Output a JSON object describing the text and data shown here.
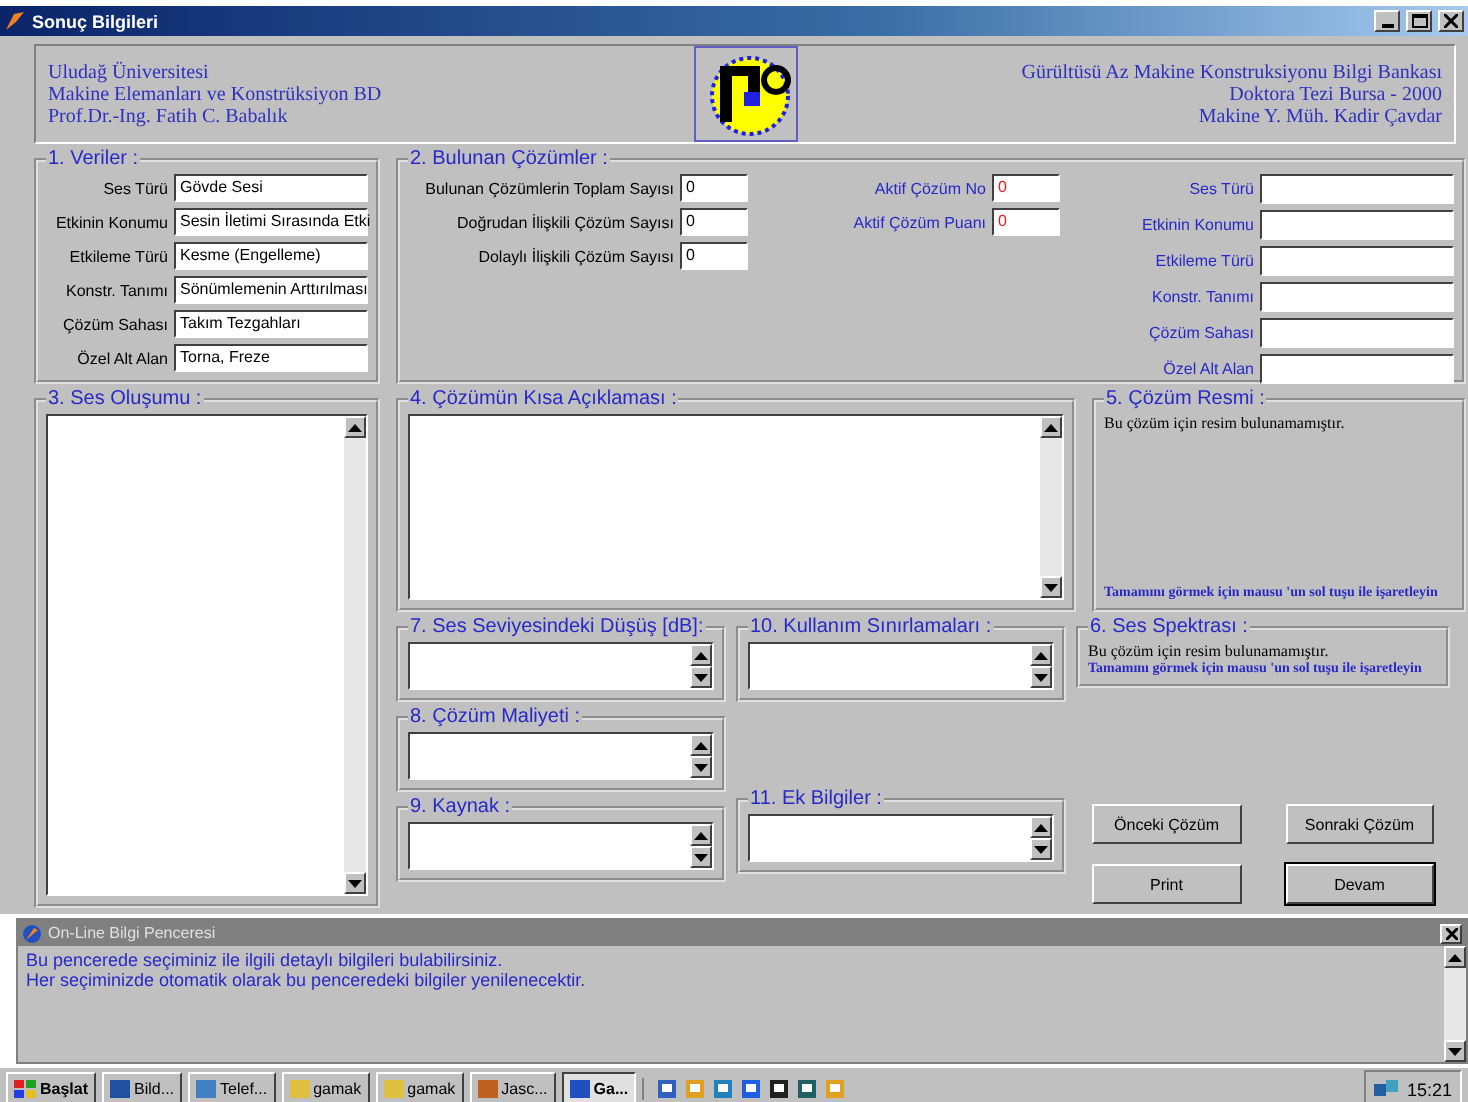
{
  "window": {
    "title": "Sonuç Bilgileri"
  },
  "header": {
    "left_lines": [
      "Uludağ Üniversitesi",
      "Makine Elemanları ve Konstrüksiyon BD",
      "Prof.Dr.-Ing. Fatih C. Babalık"
    ],
    "right_lines": [
      "Gürültüsü Az Makine Konstruksiyonu Bilgi Bankası",
      "Doktora Tezi Bursa - 2000",
      "Makine Y. Müh. Kadir Çavdar"
    ]
  },
  "veriler": {
    "title": "1. Veriler :",
    "fields": [
      {
        "label": "Ses Türü",
        "value": "Gövde Sesi"
      },
      {
        "label": "Etkinin Konumu",
        "value": "Sesin İletimi Sırasında Etki"
      },
      {
        "label": "Etkileme Türü",
        "value": "Kesme (Engelleme)"
      },
      {
        "label": "Konstr. Tanımı",
        "value": "Sönümlemenin Arttırılması"
      },
      {
        "label": "Çözüm Sahası",
        "value": "Takım Tezgahları"
      },
      {
        "label": "Özel Alt Alan",
        "value": "Torna, Freze"
      }
    ]
  },
  "bulunan": {
    "title": "2. Bulunan Çözümler :",
    "counts": [
      {
        "label": "Bulunan Çözümlerin Toplam Sayısı",
        "value": "0"
      },
      {
        "label": "Doğrudan İlişkili Çözüm Sayısı",
        "value": "0"
      },
      {
        "label": "Dolaylı İlişkili Çözüm Sayısı",
        "value": "0"
      }
    ],
    "active": [
      {
        "label": "Aktif Çözüm No",
        "value": "0"
      },
      {
        "label": "Aktif Çözüm Puanı",
        "value": "0"
      }
    ],
    "fields": [
      {
        "label": "Ses Türü"
      },
      {
        "label": "Etkinin Konumu"
      },
      {
        "label": "Etkileme Türü"
      },
      {
        "label": "Konstr. Tanımı"
      },
      {
        "label": "Çözüm Sahası"
      },
      {
        "label": "Özel Alt Alan"
      }
    ]
  },
  "ses_olusumu": {
    "title": "3. Ses Oluşumu :"
  },
  "aciklama": {
    "title": "4. Çözümün Kısa Açıklaması :"
  },
  "cozum_resmi": {
    "title": "5. Çözüm Resmi :",
    "note": "Bu çözüm için resim bulunamamıştır.",
    "hint": "Tamamını görmek için mausu 'un sol tuşu ile işaretleyin"
  },
  "ses_seviyesi": {
    "title": "7. Ses Seviyesindeki Düşüş [dB]:"
  },
  "maliyet": {
    "title": "8. Çözüm Maliyeti :"
  },
  "kaynak": {
    "title": "9. Kaynak :"
  },
  "sinirlamalar": {
    "title": "10. Kullanım Sınırlamaları :"
  },
  "ek_bilgiler": {
    "title": "11. Ek Bilgiler :"
  },
  "ses_spektrasi": {
    "title": "6. Ses Spektrası :",
    "note": "Bu çözüm için resim bulunamamıştır.",
    "hint": "Tamamını görmek için mausu 'un sol tuşu ile işaretleyin"
  },
  "buttons": [
    {
      "label": "Önceki Çözüm",
      "default": false
    },
    {
      "label": "Sonraki Çözüm",
      "default": false
    },
    {
      "label": "Print",
      "default": false
    },
    {
      "label": "Devam",
      "default": true
    }
  ],
  "info_window": {
    "title": "On-Line Bilgi Penceresi",
    "lines": [
      "Bu pencerede seçiminiz ile ilgili detaylı bilgileri bulabilirsiniz.",
      "Her seçiminizde otomatik olarak bu penceredeki bilgiler yenilenecektir."
    ]
  },
  "taskbar": {
    "start": "Başlat",
    "tasks": [
      {
        "label": "Bild...",
        "selected": false
      },
      {
        "label": "Telef...",
        "selected": false
      },
      {
        "label": "gamak",
        "selected": false
      },
      {
        "label": "gamak",
        "selected": false
      },
      {
        "label": "Jasc...",
        "selected": false
      },
      {
        "label": "Ga...",
        "selected": true
      }
    ],
    "clock": "15:21"
  }
}
